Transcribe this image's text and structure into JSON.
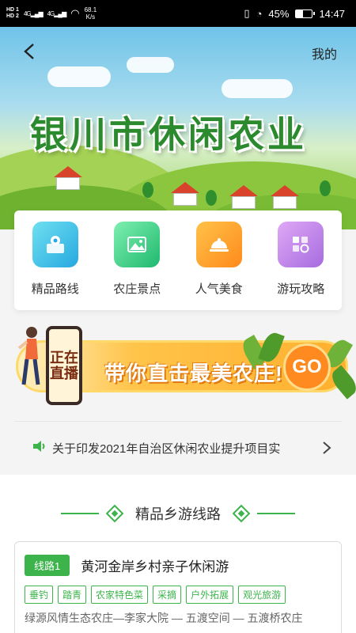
{
  "status_bar": {
    "hd1": "HD 1",
    "hd2": "HD 2",
    "signal1": "4G",
    "signal2": "4G",
    "speed_value": "68.1",
    "speed_unit": "K/s",
    "battery": "45%",
    "time": "14:47",
    "battery_level": 0.45
  },
  "nav": {
    "mine_label": "我的"
  },
  "banner": {
    "title": "银川市休闲农业"
  },
  "categories": [
    {
      "label": "精品路线",
      "icon": "map-pin-icon",
      "color": "#3cc9e6"
    },
    {
      "label": "农庄景点",
      "icon": "scenery-icon",
      "color": "#36d08e"
    },
    {
      "label": "人气美食",
      "icon": "food-cloche-icon",
      "color": "#ffa62a"
    },
    {
      "label": "游玩攻略",
      "icon": "guide-icon",
      "color": "#c58ae8"
    }
  ],
  "live": {
    "phone_text_1": "正在",
    "phone_text_2": "直播",
    "slogan": "带你直击最美农庄!",
    "go_label": "GO"
  },
  "notice": {
    "text": "关于印发2021年自治区休闲农业提升项目实"
  },
  "section": {
    "title": "精品乡游线路"
  },
  "route": {
    "badge": "线路1",
    "title": "黄河金岸乡村亲子休闲游",
    "tags": [
      "垂钓",
      "踏青",
      "农家特色菜",
      "采摘",
      "户外拓展",
      "观光旅游"
    ],
    "path": "绿源风情生态农庄—李家大院 — 五渡空间 — 五渡桥农庄"
  },
  "colors": {
    "accent": "#3cb44b",
    "status_bg": "#000000"
  }
}
